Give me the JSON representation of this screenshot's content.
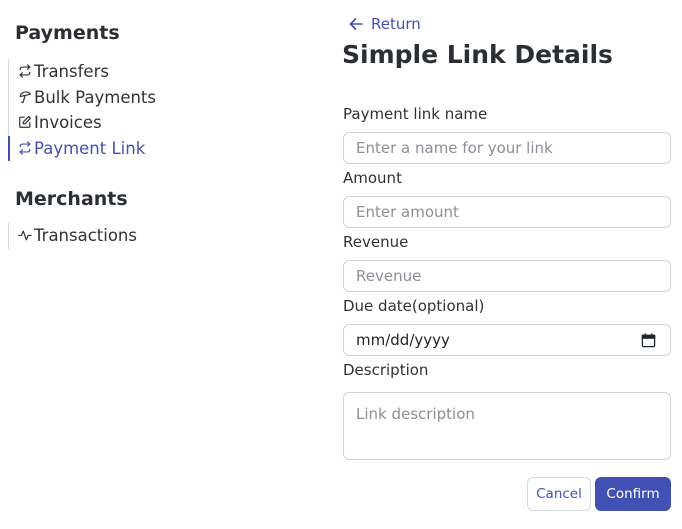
{
  "sidebar": {
    "sections": [
      {
        "title": "Payments",
        "items": [
          {
            "label": "Transfers",
            "icon": "arrows-repeat-icon",
            "active": false
          },
          {
            "label": "Bulk Payments",
            "icon": "umbrella-icon",
            "active": false
          },
          {
            "label": "Invoices",
            "icon": "edit-icon",
            "active": false
          },
          {
            "label": "Payment Link",
            "icon": "arrows-repeat-icon",
            "active": true
          }
        ]
      },
      {
        "title": "Merchants",
        "items": [
          {
            "label": "Transactions",
            "icon": "activity-icon",
            "active": false
          }
        ]
      }
    ]
  },
  "header": {
    "return_label": "Return",
    "title": "Simple Link Details"
  },
  "form": {
    "link_name": {
      "label": "Payment link name",
      "placeholder": "Enter a name for your link",
      "value": ""
    },
    "amount": {
      "label": "Amount",
      "placeholder": "Enter amount",
      "value": ""
    },
    "revenue": {
      "label": "Revenue",
      "placeholder": "Revenue",
      "value": ""
    },
    "due_date": {
      "label": "Due date(optional)",
      "value": "mm/dd/yyyy"
    },
    "description": {
      "label": "Description",
      "placeholder": "Link description",
      "value": ""
    }
  },
  "actions": {
    "cancel_label": "Cancel",
    "confirm_label": "Confirm"
  },
  "colors": {
    "accent": "#4350b3",
    "text": "#2b2f33",
    "border": "#ced4da",
    "placeholder": "#8b9096"
  }
}
